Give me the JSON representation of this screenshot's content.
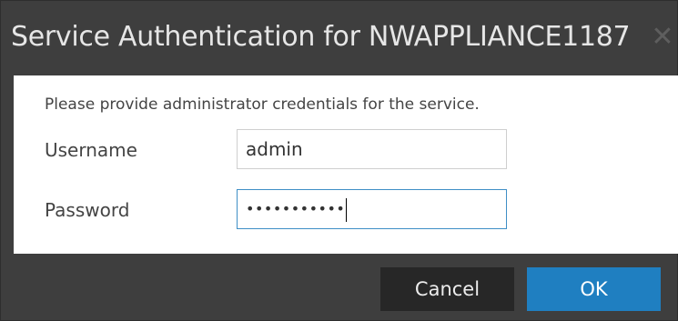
{
  "dialog": {
    "title": "Service Authentication for NWAPPLIANCE1187",
    "close_glyph": "✕",
    "instruction": "Please provide administrator credentials for the service."
  },
  "form": {
    "username_label": "Username",
    "username_value": "admin",
    "password_label": "Password",
    "password_masked": "•••••••••••"
  },
  "buttons": {
    "cancel_label": "Cancel",
    "ok_label": "OK"
  },
  "colors": {
    "dialog_background": "#3e3e3e",
    "content_background": "#ffffff",
    "primary_button": "#1f7fc1",
    "secondary_button": "#272727",
    "focus_border": "#3f8fc6"
  }
}
